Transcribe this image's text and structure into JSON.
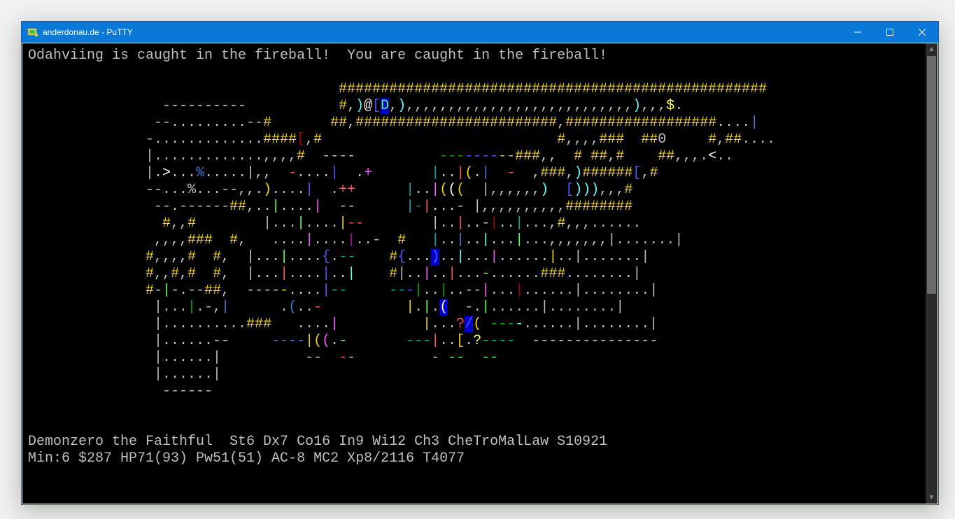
{
  "window": {
    "title": "anderdonau.de - PuTTY"
  },
  "message": "Odahviing is caught in the fireball!  You are caught in the fireball!",
  "status": {
    "line1": "Demonzero the Faithful  St6 Dx7 Co16 In9 Wi12 Ch3 CheTroMalLaw S10921",
    "line2": "Min:6 $287 HP71(93) Pw51(51) AC-8 MC2 Xp8/2116 T4077"
  },
  "map_rows": [
    {
      "segments": [
        {
          "t": "                                     ",
          "c": "gr"
        },
        {
          "t": "###################################################",
          "c": "ye"
        }
      ]
    },
    {
      "segments": [
        {
          "t": "                ----------           ",
          "c": "gr"
        },
        {
          "t": "#",
          "c": "ye"
        },
        {
          "t": ",",
          "c": "gr"
        },
        {
          "t": ")",
          "c": "bc"
        },
        {
          "t": "@",
          "c": "wh"
        },
        {
          "t": "[",
          "c": "bb"
        },
        {
          "t": "D",
          "c": "bg",
          "bg": "bgb"
        },
        {
          "t": ",",
          "c": "gr"
        },
        {
          "t": ")",
          "c": "bc"
        },
        {
          "t": ",,,,,,,,,,,,,,,,,,,,,,,,,,,",
          "c": "gr"
        },
        {
          "t": ")",
          "c": "bc"
        },
        {
          "t": ",,,",
          "c": "gr"
        },
        {
          "t": "$",
          "c": "by"
        },
        {
          "t": ".",
          "c": "gr"
        }
      ]
    },
    {
      "segments": [
        {
          "t": "               --.........--",
          "c": "gr"
        },
        {
          "t": "#       ##",
          "c": "ye"
        },
        {
          "t": ",",
          "c": "gr"
        },
        {
          "t": "########################",
          "c": "ye"
        },
        {
          "t": ",",
          "c": "gr"
        },
        {
          "t": "##################",
          "c": "ye"
        },
        {
          "t": "....",
          "c": "gr"
        },
        {
          "t": "|",
          "c": "bl"
        }
      ]
    },
    {
      "segments": [
        {
          "t": "              -.............",
          "c": "gr"
        },
        {
          "t": "####",
          "c": "ye"
        },
        {
          "t": "[",
          "c": "rd"
        },
        {
          "t": ",",
          "c": "gr"
        },
        {
          "t": "#",
          "c": "ye"
        },
        {
          "t": "                            ",
          "c": "gr"
        },
        {
          "t": "#",
          "c": "ye"
        },
        {
          "t": ",,,,",
          "c": "gr"
        },
        {
          "t": "###  ##",
          "c": "ye"
        },
        {
          "t": "0     ",
          "c": "gr"
        },
        {
          "t": "#",
          "c": "ye"
        },
        {
          "t": ",",
          "c": "gr"
        },
        {
          "t": "##",
          "c": "ye"
        },
        {
          "t": "....",
          "c": "gr"
        }
      ]
    },
    {
      "segments": [
        {
          "t": "              |.............,,,,",
          "c": "gr"
        },
        {
          "t": "#",
          "c": "ye"
        },
        {
          "t": "  ----          ",
          "c": "gr"
        },
        {
          "t": "---",
          "c": "gn"
        },
        {
          "t": "----",
          "c": "bb"
        },
        {
          "t": "--",
          "c": "gr"
        },
        {
          "t": "###",
          "c": "ye"
        },
        {
          "t": ",,  ",
          "c": "gr"
        },
        {
          "t": "# ##",
          "c": "ye"
        },
        {
          "t": ",",
          "c": "gr"
        },
        {
          "t": "#    ##",
          "c": "ye"
        },
        {
          "t": ",,,.",
          "c": "gr"
        },
        {
          "t": "<",
          "c": "wh"
        },
        {
          "t": "..",
          "c": "gr"
        }
      ]
    },
    {
      "segments": [
        {
          "t": "              |.",
          "c": "gr"
        },
        {
          "t": ">",
          "c": "wh"
        },
        {
          "t": "...",
          "c": "gr"
        },
        {
          "t": "%",
          "c": "bl"
        },
        {
          "t": ".....|,,  ",
          "c": "gr"
        },
        {
          "t": "-",
          "c": "br"
        },
        {
          "t": "....",
          "c": "gr"
        },
        {
          "t": "|",
          "c": "bb"
        },
        {
          "t": "  .",
          "c": "gr"
        },
        {
          "t": "+",
          "c": "bm"
        },
        {
          "t": "       ",
          "c": "gr"
        },
        {
          "t": "|",
          "c": "cy"
        },
        {
          "t": "..",
          "c": "gr"
        },
        {
          "t": "|",
          "c": "br"
        },
        {
          "t": "(",
          "c": "ye"
        },
        {
          "t": ".",
          "c": "gr"
        },
        {
          "t": "|",
          "c": "bl"
        },
        {
          "t": "  ",
          "c": "gr"
        },
        {
          "t": "-",
          "c": "br"
        },
        {
          "t": "  ,",
          "c": "gr"
        },
        {
          "t": "###",
          "c": "ye"
        },
        {
          "t": ",",
          "c": "gr"
        },
        {
          "t": ")",
          "c": "bc"
        },
        {
          "t": "######",
          "c": "ye"
        },
        {
          "t": "[",
          "c": "bb"
        },
        {
          "t": ",",
          "c": "gr"
        },
        {
          "t": "#",
          "c": "ye"
        }
      ]
    },
    {
      "segments": [
        {
          "t": "              --...",
          "c": "gr"
        },
        {
          "t": "%",
          "c": "gr"
        },
        {
          "t": "...--,,.",
          "c": "gr"
        },
        {
          "t": ")",
          "c": "ye"
        },
        {
          "t": "....",
          "c": "gr"
        },
        {
          "t": "|",
          "c": "bb"
        },
        {
          "t": "  .",
          "c": "gr"
        },
        {
          "t": "++",
          "c": "br"
        },
        {
          "t": "      ",
          "c": "gr"
        },
        {
          "t": "|",
          "c": "cy"
        },
        {
          "t": "..",
          "c": "gr"
        },
        {
          "t": "|",
          "c": "bm"
        },
        {
          "t": "(",
          "c": "ye"
        },
        {
          "t": "(",
          "c": "wh"
        },
        {
          "t": "(",
          "c": "ye"
        },
        {
          "t": "  |",
          "c": "gr"
        },
        {
          "t": ",,,,,,",
          "c": "gr"
        },
        {
          "t": ")",
          "c": "bc"
        },
        {
          "t": "  ",
          "c": "gr"
        },
        {
          "t": "[",
          "c": "bb"
        },
        {
          "t": ")))",
          "c": "bc"
        },
        {
          "t": ",,,",
          "c": "gr"
        },
        {
          "t": "#",
          "c": "ye"
        }
      ]
    },
    {
      "segments": [
        {
          "t": "               --.------",
          "c": "gr"
        },
        {
          "t": "##",
          "c": "ye"
        },
        {
          "t": ",..",
          "c": "gr"
        },
        {
          "t": "|",
          "c": "bg"
        },
        {
          "t": "....",
          "c": "gr"
        },
        {
          "t": "|",
          "c": "bm"
        },
        {
          "t": "  --      ",
          "c": "gr"
        },
        {
          "t": "|",
          "c": "cy"
        },
        {
          "t": "-",
          "c": "gn"
        },
        {
          "t": "|",
          "c": "br"
        },
        {
          "t": "...",
          "c": "gr"
        },
        {
          "t": "- ",
          "c": "gr"
        },
        {
          "t": "|",
          "c": "gr"
        },
        {
          "t": ",,,,,,,,,,",
          "c": "gr"
        },
        {
          "t": "########",
          "c": "ye"
        }
      ]
    },
    {
      "segments": [
        {
          "t": "                ",
          "c": "gr"
        },
        {
          "t": "#",
          "c": "ye"
        },
        {
          "t": ",,",
          "c": "gr"
        },
        {
          "t": "#",
          "c": "ye"
        },
        {
          "t": "        |...",
          "c": "gr"
        },
        {
          "t": "|",
          "c": "bg"
        },
        {
          "t": "....",
          "c": "gr"
        },
        {
          "t": "|",
          "c": "ye"
        },
        {
          "t": "--",
          "c": "br"
        },
        {
          "t": "        ",
          "c": "gr"
        },
        {
          "t": "|",
          "c": "gr"
        },
        {
          "t": "..",
          "c": "gr"
        },
        {
          "t": "|",
          "c": "br"
        },
        {
          "t": "..-",
          "c": "gr"
        },
        {
          "t": "|",
          "c": "rd"
        },
        {
          "t": "..",
          "c": "gr"
        },
        {
          "t": "|",
          "c": "cy"
        },
        {
          "t": "...,",
          "c": "gr"
        },
        {
          "t": "#",
          "c": "ye"
        },
        {
          "t": ",,,......",
          "c": "gr"
        }
      ]
    },
    {
      "segments": [
        {
          "t": "               ,,,,",
          "c": "gr"
        },
        {
          "t": "###  #",
          "c": "ye"
        },
        {
          "t": ",   ....",
          "c": "gr"
        },
        {
          "t": "|",
          "c": "bm"
        },
        {
          "t": "....",
          "c": "gr"
        },
        {
          "t": "|",
          "c": "mg"
        },
        {
          "t": "..",
          "c": "gr"
        },
        {
          "t": "-",
          "c": "bg"
        },
        {
          "t": "  ",
          "c": "gr"
        },
        {
          "t": "#",
          "c": "ye"
        },
        {
          "t": "   ",
          "c": "gr"
        },
        {
          "t": "|",
          "c": "cy"
        },
        {
          "t": "..",
          "c": "gr"
        },
        {
          "t": "|",
          "c": "bl"
        },
        {
          "t": "..",
          "c": "gr"
        },
        {
          "t": "|",
          "c": "bc"
        },
        {
          "t": "...",
          "c": "gr"
        },
        {
          "t": "|",
          "c": "bg"
        },
        {
          "t": "...,,,,,,,",
          "c": "gr"
        },
        {
          "t": "|",
          "c": "gr"
        },
        {
          "t": ".......",
          "c": "gr"
        },
        {
          "t": "|",
          "c": "gr"
        }
      ]
    },
    {
      "segments": [
        {
          "t": "              ",
          "c": "gr"
        },
        {
          "t": "#",
          "c": "ye"
        },
        {
          "t": ",,,,",
          "c": "gr"
        },
        {
          "t": "#  #",
          "c": "ye"
        },
        {
          "t": ",  ",
          "c": "gr"
        },
        {
          "t": "|",
          "c": "gr"
        },
        {
          "t": "...",
          "c": "gr"
        },
        {
          "t": "|",
          "c": "bg"
        },
        {
          "t": "....",
          "c": "gr"
        },
        {
          "t": "{",
          "c": "bb"
        },
        {
          "t": ".",
          "c": "gr"
        },
        {
          "t": "--",
          "c": "cy"
        },
        {
          "t": "    ",
          "c": "gr"
        },
        {
          "t": "#",
          "c": "ye"
        },
        {
          "t": "{",
          "c": "bb"
        },
        {
          "t": "...",
          "c": "gr"
        },
        {
          "t": ")",
          "c": "bb",
          "bg": "bgb"
        },
        {
          "t": "..",
          "c": "gr"
        },
        {
          "t": "|",
          "c": "bc"
        },
        {
          "t": "...",
          "c": "gr"
        },
        {
          "t": "|",
          "c": "bm"
        },
        {
          "t": "......",
          "c": "gr"
        },
        {
          "t": "|",
          "c": "ye"
        },
        {
          "t": "..|.......|",
          "c": "gr"
        }
      ]
    },
    {
      "segments": [
        {
          "t": "              ",
          "c": "gr"
        },
        {
          "t": "#",
          "c": "ye"
        },
        {
          "t": ",,",
          "c": "gr"
        },
        {
          "t": "#",
          "c": "ye"
        },
        {
          "t": ",",
          "c": "gr"
        },
        {
          "t": "#  #",
          "c": "ye"
        },
        {
          "t": ",  |...",
          "c": "gr"
        },
        {
          "t": "|",
          "c": "br"
        },
        {
          "t": "....",
          "c": "gr"
        },
        {
          "t": "|",
          "c": "bb"
        },
        {
          "t": "..",
          "c": "gr"
        },
        {
          "t": "|",
          "c": "bc"
        },
        {
          "t": "    ",
          "c": "gr"
        },
        {
          "t": "#",
          "c": "ye"
        },
        {
          "t": "|",
          "c": "gr"
        },
        {
          "t": "..",
          "c": "gr"
        },
        {
          "t": "|",
          "c": "bm"
        },
        {
          "t": "..",
          "c": "gr"
        },
        {
          "t": "|",
          "c": "br"
        },
        {
          "t": "...",
          "c": "gr"
        },
        {
          "t": "-",
          "c": "bg"
        },
        {
          "t": "......",
          "c": "gr"
        },
        {
          "t": "###",
          "c": "ye"
        },
        {
          "t": "........|",
          "c": "gr"
        }
      ]
    },
    {
      "segments": [
        {
          "t": "              ",
          "c": "gr"
        },
        {
          "t": "#",
          "c": "ye"
        },
        {
          "t": "-",
          "c": "gr"
        },
        {
          "t": "|",
          "c": "bg"
        },
        {
          "t": "-.--",
          "c": "gr"
        },
        {
          "t": "##",
          "c": "ye"
        },
        {
          "t": ",  ----",
          "c": "gr"
        },
        {
          "t": "-",
          "c": "ye"
        },
        {
          "t": "....",
          "c": "gr"
        },
        {
          "t": "|",
          "c": "bb"
        },
        {
          "t": "--",
          "c": "cy"
        },
        {
          "t": "     ",
          "c": "gr"
        },
        {
          "t": "--",
          "c": "cy"
        },
        {
          "t": "-",
          "c": "bb"
        },
        {
          "t": "|",
          "c": "gn"
        },
        {
          "t": "..",
          "c": "gr"
        },
        {
          "t": "|",
          "c": "gn"
        },
        {
          "t": "..--",
          "c": "gr"
        },
        {
          "t": "|",
          "c": "bm"
        },
        {
          "t": "...",
          "c": "gr"
        },
        {
          "t": "|",
          "c": "rd"
        },
        {
          "t": "......|........|",
          "c": "gr"
        }
      ]
    },
    {
      "segments": [
        {
          "t": "               |...",
          "c": "gr"
        },
        {
          "t": "|",
          "c": "gn"
        },
        {
          "t": ".-,",
          "c": "gr"
        },
        {
          "t": "|",
          "c": "bl"
        },
        {
          "t": "      .",
          "c": "gr"
        },
        {
          "t": "(",
          "c": "bl"
        },
        {
          "t": "..",
          "c": "gr"
        },
        {
          "t": "-",
          "c": "br"
        },
        {
          "t": "          ",
          "c": "gr"
        },
        {
          "t": "|",
          "c": "ye"
        },
        {
          "t": ".",
          "c": "gr"
        },
        {
          "t": "|",
          "c": "bg"
        },
        {
          "t": ".",
          "c": "gr"
        },
        {
          "t": "(",
          "c": "wh",
          "bg": "bgb"
        },
        {
          "t": "  ",
          "c": "gr"
        },
        {
          "t": "-.",
          "c": "gr"
        },
        {
          "t": "|",
          "c": "bg"
        },
        {
          "t": "......|........|",
          "c": "gr"
        }
      ]
    },
    {
      "segments": [
        {
          "t": "               |..........",
          "c": "gr"
        },
        {
          "t": "###",
          "c": "ye"
        },
        {
          "t": "   ....",
          "c": "gr"
        },
        {
          "t": "|",
          "c": "bm"
        },
        {
          "t": "          ",
          "c": "gr"
        },
        {
          "t": "|",
          "c": "ye"
        },
        {
          "t": "...",
          "c": "gr"
        },
        {
          "t": "?",
          "c": "br"
        },
        {
          "t": "/",
          "c": "bb",
          "bg": "bgb"
        },
        {
          "t": "(",
          "c": "ye"
        },
        {
          "t": " ",
          "c": "gr"
        },
        {
          "t": "---",
          "c": "gn"
        },
        {
          "t": "-",
          "c": "bc"
        },
        {
          "t": "......|........|",
          "c": "gr"
        }
      ]
    },
    {
      "segments": [
        {
          "t": "               |......--     ",
          "c": "gr"
        },
        {
          "t": "----",
          "c": "bl"
        },
        {
          "t": "|",
          "c": "ye"
        },
        {
          "t": "(",
          "c": "ye"
        },
        {
          "t": "(",
          "c": "bm"
        },
        {
          "t": ".",
          "c": "gr"
        },
        {
          "t": "-",
          "c": "bg"
        },
        {
          "t": "       ",
          "c": "gr"
        },
        {
          "t": "---",
          "c": "cy"
        },
        {
          "t": "|",
          "c": "br"
        },
        {
          "t": "..",
          "c": "gr"
        },
        {
          "t": "[",
          "c": "ye"
        },
        {
          "t": ".",
          "c": "gr"
        },
        {
          "t": "?",
          "c": "by"
        },
        {
          "t": "----",
          "c": "cy"
        },
        {
          "t": "  ---------------",
          "c": "gr"
        }
      ]
    },
    {
      "segments": [
        {
          "t": "               |......|          --  ",
          "c": "gr"
        },
        {
          "t": "-",
          "c": "br"
        },
        {
          "t": "-         ",
          "c": "gr"
        },
        {
          "t": "- ",
          "c": "gr"
        },
        {
          "t": "--",
          "c": "bg"
        },
        {
          "t": "  ",
          "c": "gr"
        },
        {
          "t": "--",
          "c": "bg"
        }
      ]
    },
    {
      "segments": [
        {
          "t": "               |......|",
          "c": "gr"
        }
      ]
    },
    {
      "segments": [
        {
          "t": "                ------",
          "c": "gr"
        }
      ]
    }
  ]
}
